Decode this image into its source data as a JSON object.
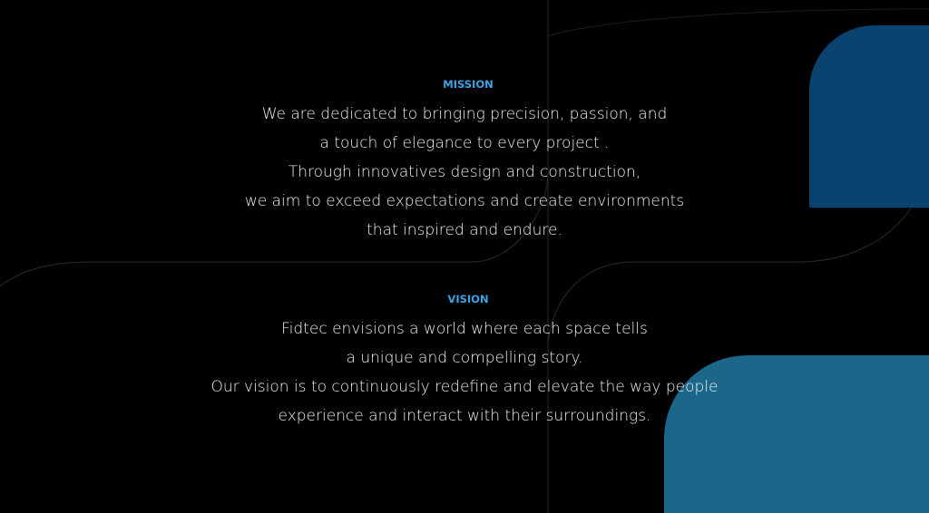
{
  "colors": {
    "background": "#000000",
    "heading_accent": "#3aa3e6",
    "body_text": "#f0f0f0",
    "shape_top": "#0a4370",
    "shape_bottom": "#1b6689"
  },
  "mission": {
    "heading": "MISSION",
    "lines": [
      "We are dedicated to bringing precision, passion, and",
      "a touch of elegance to every project .",
      "Through innovatives design and construction,",
      "we aim to exceed expectations and create environments",
      "that inspired and endure."
    ]
  },
  "vision": {
    "heading": "VISION",
    "lines": [
      "Fidtec envisions a world where each space tells",
      "a unique and compelling story.",
      "Our vision is to continuously redefine and elevate the way people",
      "experience and interact with their surroundings."
    ]
  }
}
